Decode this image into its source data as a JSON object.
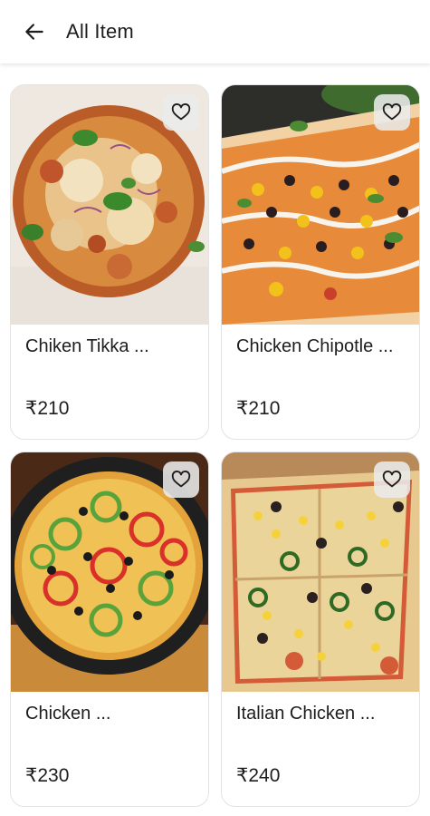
{
  "header": {
    "title": "All Item",
    "back_icon": "arrow-left-icon"
  },
  "items": [
    {
      "name": "Chiken Tikka ...",
      "price": "₹210",
      "favorite_icon": "heart-outline-icon"
    },
    {
      "name": "Chicken Chipotle ...",
      "price": "₹210",
      "favorite_icon": "heart-outline-icon"
    },
    {
      "name": "Chicken ...",
      "price": "₹230",
      "favorite_icon": "heart-outline-icon"
    },
    {
      "name": "Italian Chicken ...",
      "price": "₹240",
      "favorite_icon": "heart-outline-icon"
    }
  ],
  "colors": {
    "text": "#1d1d1d",
    "card_border": "#e3e3e3",
    "background": "#ffffff"
  }
}
